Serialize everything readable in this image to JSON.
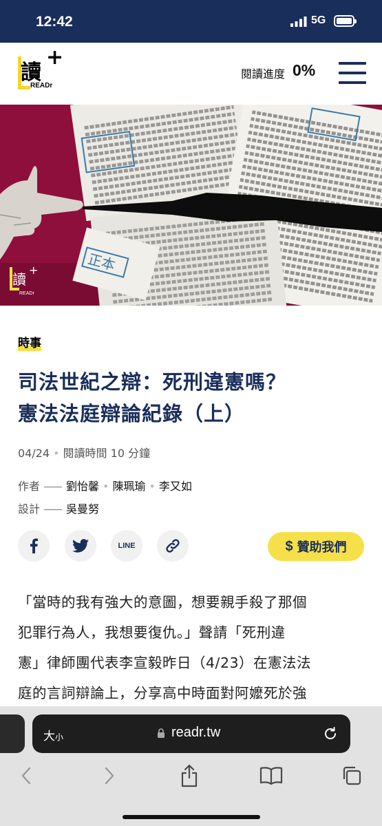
{
  "status": {
    "time": "12:42",
    "network": "5G"
  },
  "header": {
    "logo_char": "讀",
    "logo_plus": "+",
    "logo_text": "READr",
    "progress_label": "閱讀進度",
    "progress_value": "0%"
  },
  "hero": {
    "stamp_text": "正本",
    "logo_char": "讀",
    "logo_text": "READr"
  },
  "article": {
    "category": "時事",
    "title_line1": "司法世紀之辯：死刑違憲嗎？",
    "title_line2": "憲法法庭辯論紀錄（上）",
    "date": "04/24",
    "read_time": "閱讀時間 10 分鐘",
    "authors_label": "作者",
    "authors": [
      "劉怡馨",
      "陳珮瑜",
      "李又如"
    ],
    "design_label": "設計",
    "designer": "吳曼努",
    "share": {
      "line_label": "LINE"
    },
    "donate_label": "贊助我們",
    "donate_symbol": "$",
    "body_lines": [
      "「當時的我有強大的意圖，想要親手殺了那個",
      "犯罪行為人，我想要復仇。」聲請「死刑違",
      "憲」律師團代表李宣毅昨日（4/23）在憲法法",
      "庭的言詞辯論上，分享高中時面對阿嬤死於強"
    ]
  },
  "browser": {
    "text_size": "大",
    "text_size_small": "小",
    "url": "readr.tw"
  },
  "colors": {
    "navy": "#1a2e5b",
    "yellow": "#f6e04a",
    "hero_red": "#8e0f3b"
  }
}
